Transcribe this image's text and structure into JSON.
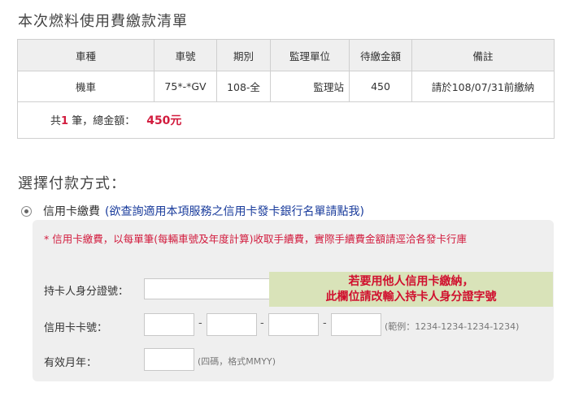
{
  "bill": {
    "title": "本次燃料使用費繳款清單",
    "headers": [
      "車種",
      "車號",
      "期別",
      "監理單位",
      "待繳金額",
      "備註"
    ],
    "rows": [
      [
        "機車",
        "75*-*GV",
        "108-全",
        "監理站",
        "450",
        "請於108/07/31前繳納"
      ]
    ],
    "total": {
      "prefix": "共",
      "count": "1",
      "suffix": " 筆，總金額：",
      "amount": "450元"
    }
  },
  "payment": {
    "title": "選擇付款方式：",
    "option_label": "信用卡繳費",
    "bank_link": "(欲查詢適用本項服務之信用卡發卡銀行名單請點我)",
    "notice": "* 信用卡繳費，以每單筆(每輛車號及年度計算)收取手續費，實際手續費金額請逕洽各發卡行庫",
    "id_label": "持卡人身分證號：",
    "card_label": "信用卡卡號：",
    "card_dash": "-",
    "card_hint": "(範例：1234-1234-1234-1234)",
    "expiry_label": "有效月年：",
    "expiry_hint": "(四碼，格式MMYY)",
    "tooltip_line1": "若要用他人信用卡繳納，",
    "tooltip_line2": "此欄位請改輸入持卡人身分證字號"
  },
  "colors": {
    "accent_red": "#d21c3e",
    "link_blue": "#1a3c9c",
    "panel_bg": "#efefef",
    "tooltip_bg": "#d9e3b9"
  }
}
